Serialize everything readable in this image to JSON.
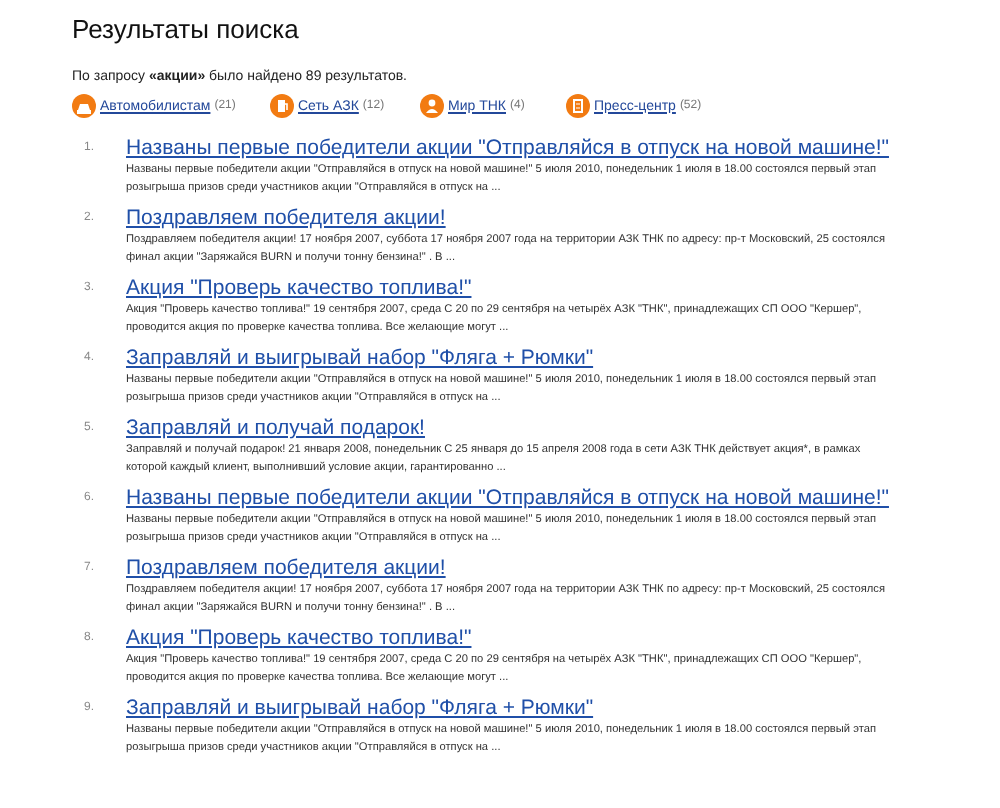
{
  "heading": "Результаты поиска",
  "summary": "По запросу **«акции»** было найдено 89 результатов.",
  "categories": [
    {
      "label": "Автомобилистам",
      "count": "(21)"
    },
    {
      "label": "Сеть АЗК",
      "count": "(12)"
    },
    {
      "label": "Мир ТНК",
      "count": "(4)"
    },
    {
      "label": "Пресс-центр",
      "count": "(52)"
    }
  ],
  "results": [
    {
      "number": "1.",
      "title": "Названы первые победители акции \"Отправляйся в отпуск на новой машине!\"",
      "snippet": "Названы первые победители акции \"Отправляйся в отпуск на новой машине!\" 5 июля 2010, понедельник 1 июля в 18.00 состоялся первый этап розыгрыша призов среди участников акции \"Отправляйся в отпуск на ..."
    },
    {
      "number": "2.",
      "title": "Поздравляем победителя акции!",
      "snippet": "Поздравляем победителя акции! 17 ноября 2007, суббота 17 ноября 2007 года на территории АЗК ТНК по адресу: пр-т Московский, 25 состоялся финал акции \"Заряжайся BURN и получи тонну бензина!\" . В ..."
    },
    {
      "number": "3.",
      "title": "Акция \"Проверь качество топлива!\"",
      "snippet": "Акция \"Проверь качество топлива!\" 19 сентября 2007, среда С 20 по 29 сентября на четырёх АЗК \"ТНК\", принадлежащих СП ООО \"Кершер\", проводится акция по проверке качества топлива. Все желающие могут ..."
    },
    {
      "number": "4.",
      "title": "Заправляй и выигрывай набор \"Фляга + Рюмки\"",
      "snippet": "Названы первые победители акции \"Отправляйся в отпуск на новой машине!\" 5 июля 2010, понедельник 1 июля в 18.00 состоялся первый этап розыгрыша призов среди участников акции \"Отправляйся в отпуск на ..."
    },
    {
      "number": "5.",
      "title": "Заправляй и получай подарок!",
      "snippet": "Заправляй и получай подарок! 21 января 2008, понедельник С 25 января до 15 апреля 2008 года в сети АЗК ТНК действует акция*, в рамках которой каждый клиент, выполнивший условие акции, гарантированно ..."
    },
    {
      "number": "6.",
      "title": "Названы первые победители акции \"Отправляйся в отпуск на новой машине!\"",
      "snippet": "Названы первые победители акции \"Отправляйся в отпуск на новой машине!\" 5 июля 2010, понедельник 1 июля в 18.00 состоялся первый этап розыгрыша призов среди участников акции \"Отправляйся в отпуск на ..."
    },
    {
      "number": "7.",
      "title": "Поздравляем победителя акции!",
      "snippet": "Поздравляем победителя акции! 17 ноября 2007, суббота 17 ноября 2007 года на территории АЗК ТНК по адресу: пр-т Московский, 25 состоялся финал акции \"Заряжайся BURN и получи тонну бензина!\" . В ..."
    },
    {
      "number": "8.",
      "title": "Акция \"Проверь качество топлива!\"",
      "snippet": "Акция \"Проверь качество топлива!\" 19 сентября 2007, среда С 20 по 29 сентября на четырёх АЗК \"ТНК\", принадлежащих СП ООО \"Кершер\", проводится акция по проверке качества топлива. Все желающие могут ..."
    },
    {
      "number": "9.",
      "title": "Заправляй и выигрывай набор \"Фляга + Рюмки\"",
      "snippet": "Названы первые победители акции \"Отправляйся в отпуск на новой машине!\" 5 июля 2010, понедельник 1 июля в 18.00 состоялся первый этап розыгрыша призов среди участников акции \"Отправляйся в отпуск на ..."
    }
  ]
}
